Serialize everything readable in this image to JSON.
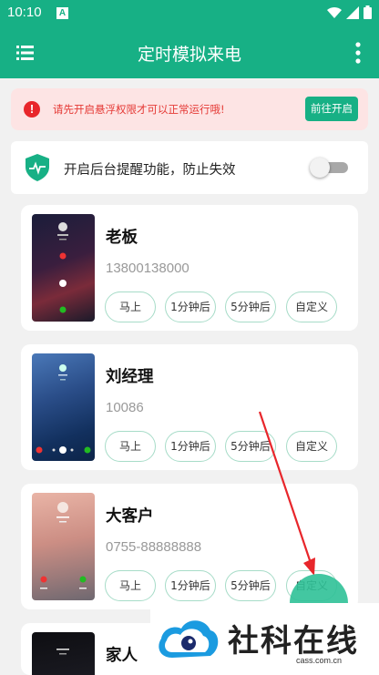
{
  "status_bar": {
    "time": "10:10",
    "a_icon": "A"
  },
  "app_bar": {
    "title": "定时模拟来电"
  },
  "warning": {
    "text": "请先开启悬浮权限才可以正常运行哦!",
    "button": "前往开启"
  },
  "background_toggle": {
    "label": "开启后台提醒功能，防止失效",
    "enabled": false
  },
  "time_options": [
    "马上",
    "1分钟后",
    "5分钟后",
    "自定义"
  ],
  "contacts": [
    {
      "name": "老板",
      "phone": "13800138000"
    },
    {
      "name": "刘经理",
      "phone": "10086"
    },
    {
      "name": "大客户",
      "phone": "0755-88888888"
    },
    {
      "name": "家人",
      "phone": ""
    }
  ],
  "watermark": {
    "brand": "社科在线",
    "domain": "cass.com.cn"
  },
  "colors": {
    "primary": "#17b085",
    "warning_bg": "#fde4e4",
    "warning_text": "#e53935"
  }
}
